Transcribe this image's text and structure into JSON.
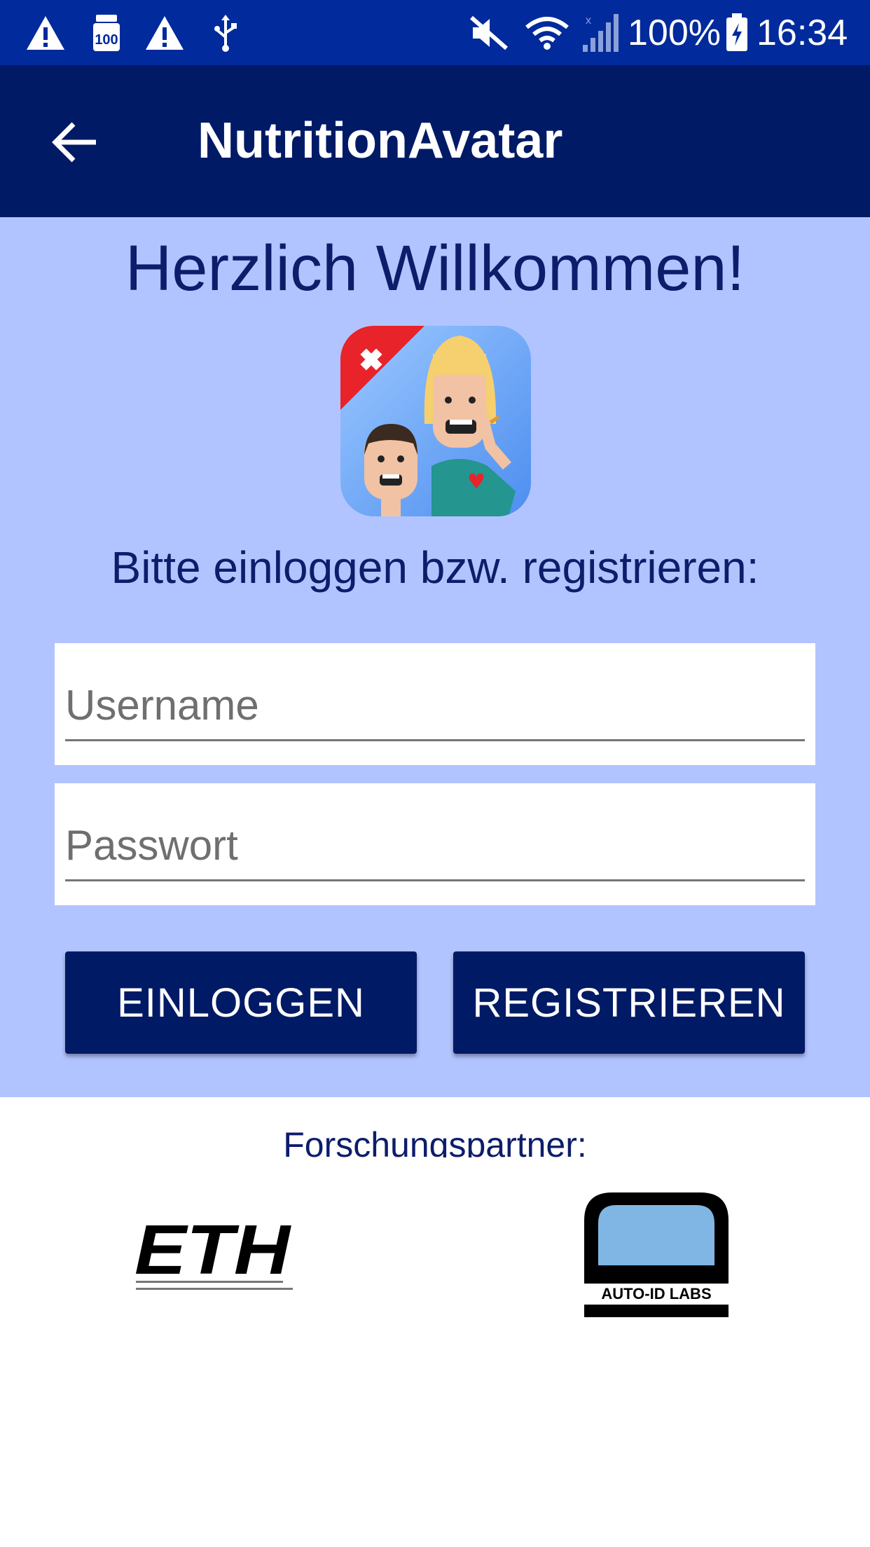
{
  "status_bar": {
    "battery": "100%",
    "time": "16:34",
    "icons": [
      "warning-icon",
      "hundred-badge-icon",
      "warning-icon",
      "usb-icon",
      "mute-icon",
      "wifi-icon",
      "signal-icon",
      "battery-charging-icon"
    ]
  },
  "app_bar": {
    "title": "NutritionAvatar",
    "back_icon": "arrow-back-icon"
  },
  "login": {
    "welcome": "Herzlich Willkommen!",
    "subtitle": "Bitte einloggen bzw. registrieren:",
    "username_placeholder": "Username",
    "username_value": "",
    "password_placeholder": "Passwort",
    "password_value": "",
    "login_label": "EINLOGGEN",
    "register_label": "REGISTRIEREN"
  },
  "partners": {
    "label": "Forschungspartner:",
    "eth_logo_text": "ETH",
    "autoid_logo_text": "AUTO-ID LABS"
  },
  "colors": {
    "status_bar": "#012a9c",
    "app_bar": "#011a66",
    "panel_bg": "#b2c4ff",
    "button_bg": "#011a66",
    "text_dark": "#0d1d6b"
  }
}
